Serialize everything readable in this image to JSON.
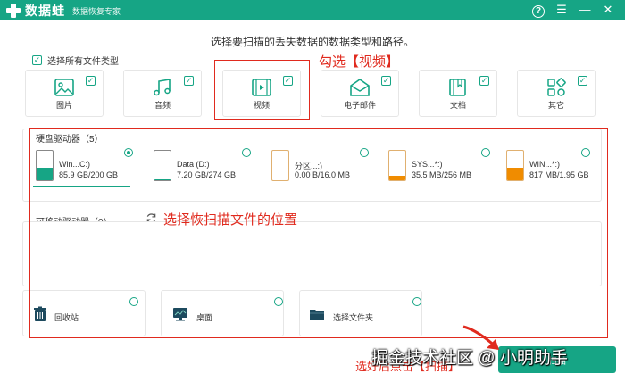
{
  "window": {
    "app_name": "数据蛙",
    "app_subtitle": "数据恢复专家",
    "controls": {
      "help_icon": "?",
      "menu_icon": "☰",
      "min_icon": "—",
      "close_icon": "✕"
    }
  },
  "prompt": "选择要扫描的丢失数据的数据类型和路径。",
  "select_all": {
    "label": "选择所有文件类型",
    "checked": true
  },
  "file_types": [
    {
      "label": "图片",
      "icon": "image-icon",
      "checked": true
    },
    {
      "label": "音频",
      "icon": "music-icon",
      "checked": true
    },
    {
      "label": "视频",
      "icon": "video-icon",
      "checked": true
    },
    {
      "label": "电子邮件",
      "icon": "email-icon",
      "checked": true
    },
    {
      "label": "文档",
      "icon": "document-icon",
      "checked": true
    },
    {
      "label": "其它",
      "icon": "other-icon",
      "checked": true
    }
  ],
  "annotations": {
    "video": "勾选【视频】",
    "location": "选择恢扫描文件的位置",
    "scan": "选好后点击【扫描】"
  },
  "hard_drives": {
    "title": "硬盘驱动器（5）",
    "items": [
      {
        "name": "Win...C:)",
        "size": "85.9 GB/200 GB",
        "used_fraction": 0.43,
        "color": "#16a585",
        "selected": true
      },
      {
        "name": "Data (D:)",
        "size": "7.20 GB/274 GB",
        "used_fraction": 0.03,
        "color": "#16a585",
        "selected": false
      },
      {
        "name": "分区...:)",
        "size": "0.00  B/16.0 MB",
        "used_fraction": 0.0,
        "color": "#f08c00",
        "selected": false
      },
      {
        "name": "SYS...*:)",
        "size": "35.5 MB/256 MB",
        "used_fraction": 0.14,
        "color": "#f08c00",
        "selected": false
      },
      {
        "name": "WIN...*:)",
        "size": "817 MB/1.95 GB",
        "used_fraction": 0.41,
        "color": "#f08c00",
        "selected": false
      }
    ]
  },
  "removable_drives": {
    "title": "可移动驱动器（0）",
    "refresh_icon": "refresh-icon"
  },
  "locations": [
    {
      "label": "回收站",
      "icon": "trash-icon"
    },
    {
      "label": "桌面",
      "icon": "desktop-icon"
    },
    {
      "label": "选择文件夹",
      "icon": "folder-icon"
    }
  ],
  "scan_button": {
    "label": "扫描"
  },
  "watermark": "掘金技术社区 @ 小明助手",
  "colors": {
    "brand": "#16a585",
    "annotation": "#e02a1e",
    "partition": "#f08c00"
  }
}
